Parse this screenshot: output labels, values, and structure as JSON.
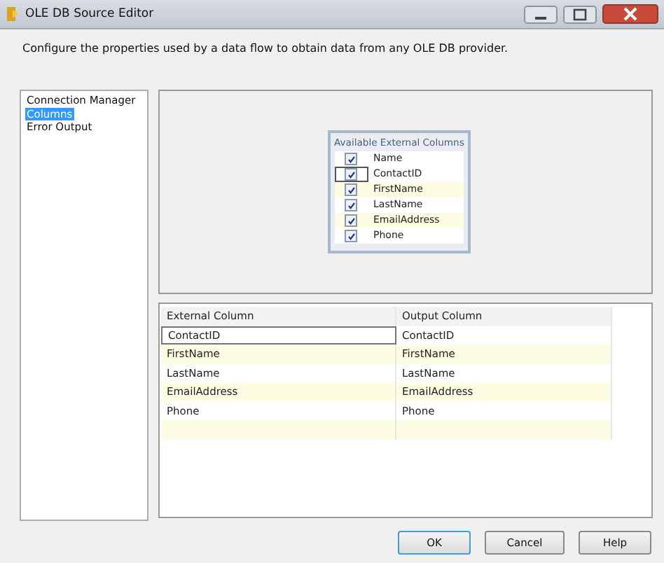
{
  "window": {
    "title": "OLE DB Source Editor"
  },
  "description": "Configure the properties used by a data flow to obtain data from any OLE DB provider.",
  "nav": [
    {
      "label": "Connection Manager",
      "selected": false
    },
    {
      "label": "Columns",
      "selected": true
    },
    {
      "label": "Error Output",
      "selected": false
    }
  ],
  "available_columns": {
    "title": "Available External Columns",
    "header": {
      "label": "Name",
      "checked": true
    },
    "items": [
      {
        "label": "ContactID",
        "checked": true
      },
      {
        "label": "FirstName",
        "checked": true
      },
      {
        "label": "LastName",
        "checked": true
      },
      {
        "label": "EmailAddress",
        "checked": true
      },
      {
        "label": "Phone",
        "checked": true
      }
    ]
  },
  "mapping": {
    "columns": [
      "External Column",
      "Output Column"
    ],
    "rows": [
      {
        "external": "ContactID",
        "output": "ContactID"
      },
      {
        "external": "FirstName",
        "output": "FirstName"
      },
      {
        "external": "LastName",
        "output": "LastName"
      },
      {
        "external": "EmailAddress",
        "output": "EmailAddress"
      },
      {
        "external": "Phone",
        "output": "Phone"
      }
    ],
    "new_row": true
  },
  "buttons": [
    "OK",
    "Cancel",
    "Help"
  ]
}
